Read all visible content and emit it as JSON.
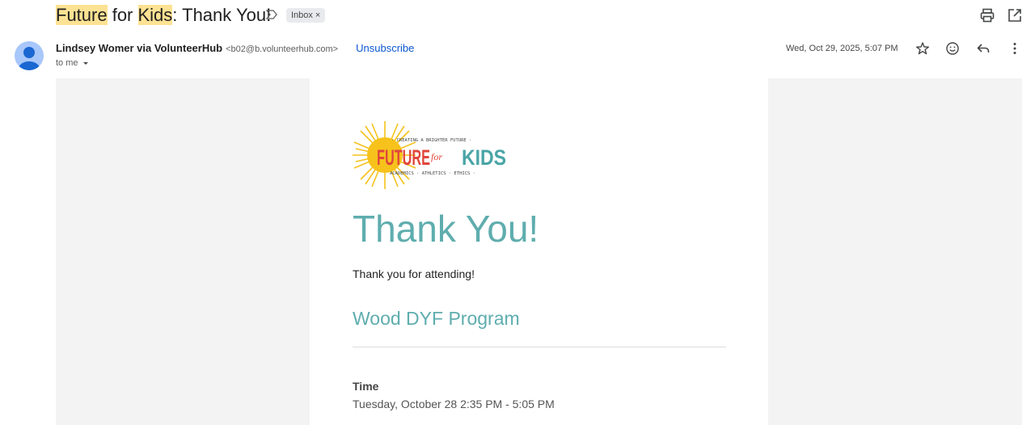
{
  "subject": {
    "part1_highlight": "Future",
    "part2": " for ",
    "part3_highlight": "Kids",
    "part4": ": Thank You!",
    "label_chip": "Inbox",
    "label_chip_close": "×"
  },
  "sender": {
    "name": "Lindsey Womer via VolunteerHub",
    "email": "<b02@b.volunteerhub.com>",
    "unsubscribe": "Unsubscribe",
    "to": "to me",
    "date": "Wed, Oct 29, 2025, 5:07 PM"
  },
  "icons": {
    "importance": "importance-marker-icon",
    "print": "print-icon",
    "popout": "open-in-new-window-icon",
    "star": "star-icon",
    "emoji": "emoji-react-icon",
    "reply": "reply-icon",
    "more": "more-vertical-icon"
  },
  "logo": {
    "tagline_top": "· CREATING A BRIGHTER FUTURE ·",
    "word_future": "FUTURE",
    "word_for": "for",
    "word_kids": "KIDS",
    "tagline_bottom": "ACADEMICS · ATHLETICS · ETHICS ·"
  },
  "email": {
    "heading": "Thank You!",
    "intro": "Thank you for attending!",
    "program": "Wood DYF Program",
    "time_label": "Time",
    "time_value": "Tuesday, October 28 2:35 PM - 5:05 PM"
  },
  "colors": {
    "accent_teal": "#5fadae",
    "link_blue": "#0b57d0",
    "highlight": "#fde293",
    "logo_red": "#e0463b",
    "logo_sun": "#f6c21b"
  }
}
